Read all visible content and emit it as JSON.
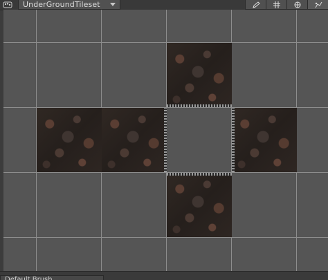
{
  "toolbar": {
    "palette_icon": "tile-palette-icon",
    "tileset_dropdown": {
      "selected": "UnderGroundTileset"
    },
    "tools": [
      {
        "icon": "pencil-icon",
        "active": false
      },
      {
        "icon": "grid-icon",
        "active": false
      },
      {
        "icon": "gizmo-icon",
        "active": false
      },
      {
        "icon": "paint-edit-icon",
        "active": true
      }
    ]
  },
  "bottom": {
    "brush_label": "Default Brush"
  },
  "colors": {
    "viewport_bg": "#555555",
    "grid_line": "#8d8d8d",
    "tile_dark": "#2c2520",
    "tile_accent": "#5a3e33"
  }
}
